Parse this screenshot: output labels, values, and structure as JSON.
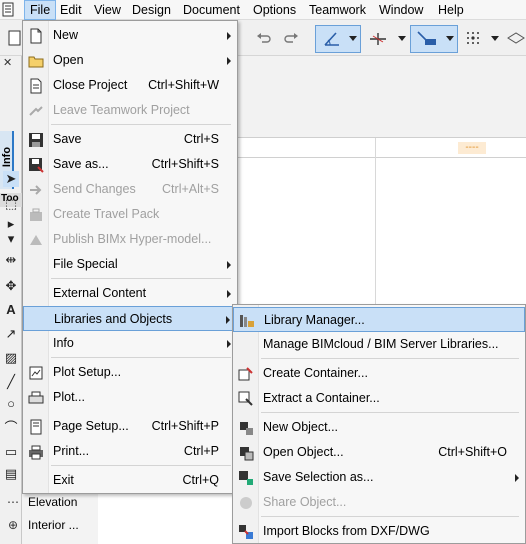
{
  "menubar": {
    "items": [
      "File",
      "Edit",
      "View",
      "Design",
      "Document",
      "Options",
      "Teamwork",
      "Window",
      "Help"
    ]
  },
  "toolbox": {
    "info_label": "Info",
    "toolbox_label": "Too"
  },
  "navigator": {
    "items": [
      {
        "label": "Elevation",
        "icon": "elevation-icon"
      },
      {
        "label": "Interior ...",
        "icon": "interior-icon"
      }
    ]
  },
  "file_menu": {
    "items": [
      {
        "label": "New",
        "shortcut": "",
        "submenu": true,
        "disabled": false,
        "icon": "new-document-icon"
      },
      {
        "label": "Open",
        "shortcut": "",
        "submenu": true,
        "disabled": false,
        "icon": "open-folder-icon"
      },
      {
        "label": "Close Project",
        "shortcut": "Ctrl+Shift+W",
        "submenu": false,
        "disabled": false,
        "icon": "close-project-icon"
      },
      {
        "label": "Leave Teamwork Project",
        "shortcut": "",
        "submenu": false,
        "disabled": true,
        "icon": "leave-teamwork-icon"
      },
      {
        "label": "Save",
        "shortcut": "Ctrl+S",
        "submenu": false,
        "disabled": false,
        "icon": "save-icon"
      },
      {
        "label": "Save as...",
        "shortcut": "Ctrl+Shift+S",
        "submenu": false,
        "disabled": false,
        "icon": "save-as-icon"
      },
      {
        "label": "Send Changes",
        "shortcut": "Ctrl+Alt+S",
        "submenu": false,
        "disabled": true,
        "icon": "send-changes-icon"
      },
      {
        "label": "Create Travel Pack",
        "shortcut": "",
        "submenu": false,
        "disabled": true,
        "icon": "travel-pack-icon"
      },
      {
        "label": "Publish BIMx Hyper-model...",
        "shortcut": "",
        "submenu": false,
        "disabled": true,
        "icon": "bimx-icon"
      },
      {
        "label": "File Special",
        "shortcut": "",
        "submenu": true,
        "disabled": false,
        "icon": ""
      },
      {
        "label": "External Content",
        "shortcut": "",
        "submenu": true,
        "disabled": false,
        "icon": ""
      },
      {
        "label": "Libraries and Objects",
        "shortcut": "",
        "submenu": true,
        "disabled": false,
        "icon": ""
      },
      {
        "label": "Info",
        "shortcut": "",
        "submenu": true,
        "disabled": false,
        "icon": ""
      },
      {
        "label": "Plot Setup...",
        "shortcut": "",
        "submenu": false,
        "disabled": false,
        "icon": "plot-setup-icon"
      },
      {
        "label": "Plot...",
        "shortcut": "",
        "submenu": false,
        "disabled": false,
        "icon": "plot-icon"
      },
      {
        "label": "Page Setup...",
        "shortcut": "Ctrl+Shift+P",
        "submenu": false,
        "disabled": false,
        "icon": "page-setup-icon"
      },
      {
        "label": "Print...",
        "shortcut": "Ctrl+P",
        "submenu": false,
        "disabled": false,
        "icon": "print-icon"
      },
      {
        "label": "Exit",
        "shortcut": "Ctrl+Q",
        "submenu": false,
        "disabled": false,
        "icon": ""
      }
    ]
  },
  "libraries_submenu": {
    "items": [
      {
        "label": "Library Manager...",
        "shortcut": "",
        "submenu": false,
        "disabled": false,
        "icon": "library-manager-icon"
      },
      {
        "label": "Manage BIMcloud / BIM Server Libraries...",
        "shortcut": "",
        "submenu": false,
        "disabled": false,
        "icon": ""
      },
      {
        "label": "Create Container...",
        "shortcut": "",
        "submenu": false,
        "disabled": false,
        "icon": "create-container-icon"
      },
      {
        "label": "Extract a Container...",
        "shortcut": "",
        "submenu": false,
        "disabled": false,
        "icon": "extract-container-icon"
      },
      {
        "label": "New Object...",
        "shortcut": "",
        "submenu": false,
        "disabled": false,
        "icon": "new-object-icon"
      },
      {
        "label": "Open Object...",
        "shortcut": "Ctrl+Shift+O",
        "submenu": false,
        "disabled": false,
        "icon": "open-object-icon"
      },
      {
        "label": "Save Selection as...",
        "shortcut": "",
        "submenu": true,
        "disabled": false,
        "icon": "save-selection-icon"
      },
      {
        "label": "Share Object...",
        "shortcut": "",
        "submenu": false,
        "disabled": true,
        "icon": "share-object-icon"
      },
      {
        "label": "Import Blocks from DXF/DWG",
        "shortcut": "",
        "submenu": false,
        "disabled": false,
        "icon": "import-blocks-icon"
      }
    ]
  },
  "colors": {
    "highlight": "#c9e0f7",
    "highlight_border": "#6aa0d8",
    "disabled_text": "#a0a0a0"
  }
}
